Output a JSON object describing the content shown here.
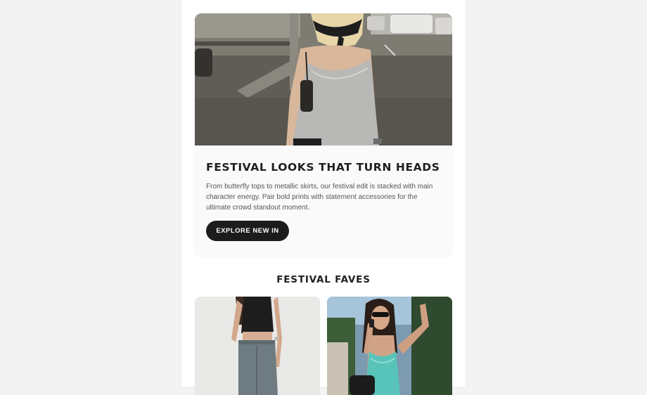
{
  "hero": {
    "image": "woman-in-silver-tank-top-with-bandana-photo",
    "headline": "FESTIVAL LOOKS THAT TURN HEADS",
    "body": "From butterfly tops to metallic skirts, our festival edit is stacked with main character energy. Pair bold prints with statement accessories for the ultimate crowd standout moment.",
    "cta_label": "EXPLORE NEW IN"
  },
  "faves": {
    "title": "FESTIVAL FAVES",
    "products": [
      {
        "image": "model-black-top-grey-jeans-photo"
      },
      {
        "image": "model-teal-lace-cami-sunglasses-photo"
      }
    ]
  },
  "colors": {
    "page_bg": "#f3f3f3",
    "card_bg": "#fafafa",
    "button_bg": "#1c1c1c",
    "text_dark": "#1f1f1f",
    "text_body": "#555555"
  }
}
